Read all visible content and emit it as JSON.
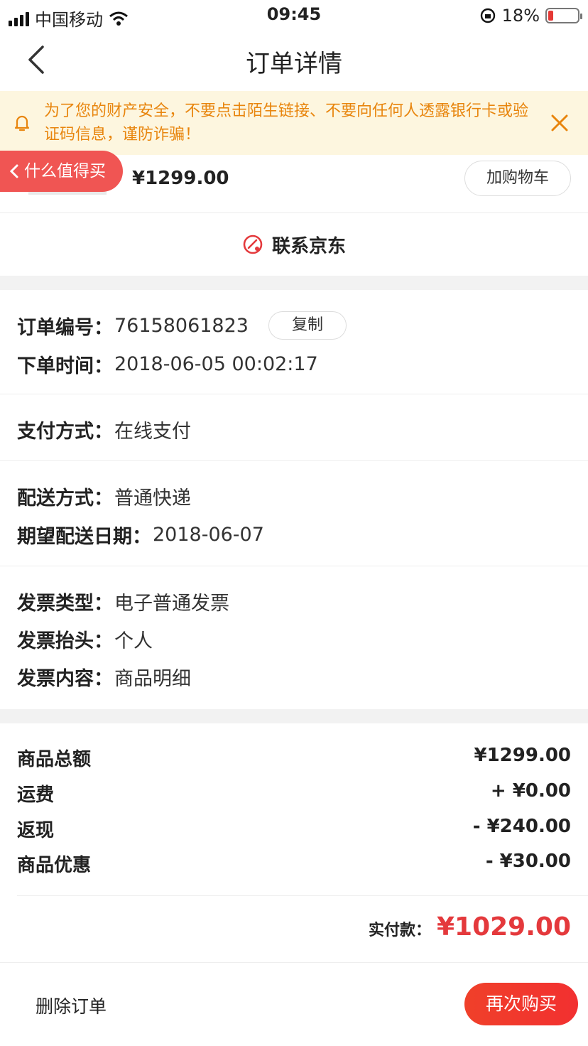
{
  "status_bar": {
    "carrier": "中国移动",
    "time": "09:45",
    "battery": "18%",
    "battery_level": 0.18
  },
  "nav": {
    "title": "订单详情"
  },
  "notice": {
    "text": "为了您的财产安全，不要点击陌生链接、不要向任何人透露银行卡或验证码信息，谨防诈骗！"
  },
  "floating": {
    "smzdm_label": "什么值得买"
  },
  "product": {
    "price": "¥1299.00",
    "cart_label": "加购物车"
  },
  "contact": {
    "label": "联系京东"
  },
  "order_info": {
    "number_label": "订单编号：",
    "number": "76158061823",
    "copy_label": "复制",
    "time_label": "下单时间：",
    "time": "2018-06-05 00:02:17"
  },
  "payment": {
    "label": "支付方式：",
    "value": "在线支付"
  },
  "delivery": {
    "method_label": "配送方式：",
    "method": "普通快递",
    "date_label": "期望配送日期：",
    "date": "2018-06-07"
  },
  "invoice": {
    "type_label": "发票类型：",
    "type": "电子普通发票",
    "title_label": "发票抬头：",
    "title": "个人",
    "content_label": "发票内容：",
    "content": "商品明细"
  },
  "amounts": [
    {
      "label": "商品总额",
      "value": "¥1299.00"
    },
    {
      "label": "运费",
      "value": "+ ¥0.00"
    },
    {
      "label": "返现",
      "value": "- ¥240.00"
    },
    {
      "label": "商品优惠",
      "value": "- ¥30.00"
    }
  ],
  "paid": {
    "label": "实付款：",
    "value": "¥1029.00"
  },
  "actions": {
    "delete_label": "删除订单",
    "buy_again_label": "再次购买"
  },
  "colors": {
    "accent": "#e4393c",
    "notice_text": "#e8850d",
    "notice_bg": "#fdf6df"
  }
}
